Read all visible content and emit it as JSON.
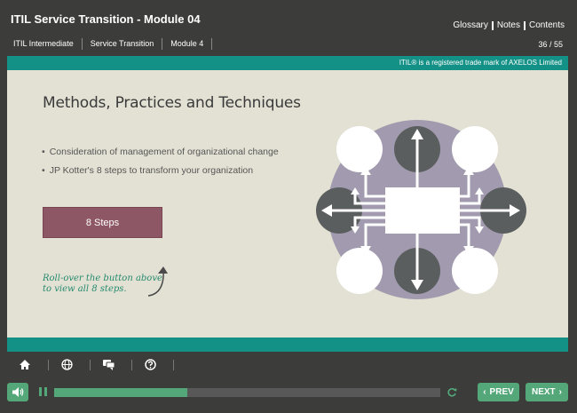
{
  "header": {
    "course_title": "ITIL Service Transition - Module 04",
    "links": [
      "Glossary",
      "Notes",
      "Contents"
    ],
    "breadcrumbs": [
      "ITIL Intermediate",
      "Service Transition",
      "Module 4"
    ],
    "page_count": "36 / 55"
  },
  "trademark": "ITIL® is a registered trade mark of AXELOS Limited",
  "slide": {
    "title": "Methods, Practices and Techniques",
    "bullets": [
      "Consideration of management of organizational change",
      "JP Kotter's 8 steps to transform your organization"
    ],
    "button_label": "8 Steps",
    "hint_line1": "Roll-over the button above",
    "hint_line2": "to view all 8 steps."
  },
  "toolbar": {
    "icons": [
      "home-icon",
      "globe-icon",
      "chat-icon",
      "help-icon"
    ]
  },
  "player": {
    "progress": 0.345,
    "prev_label": "PREV",
    "next_label": "NEXT"
  },
  "colors": {
    "teal": "#149186",
    "green": "#53a778",
    "button": "#8e5765",
    "slide_bg": "#e3e1d4",
    "diagram_purple": "#a29aae",
    "diagram_dark": "#5a5e5e"
  }
}
